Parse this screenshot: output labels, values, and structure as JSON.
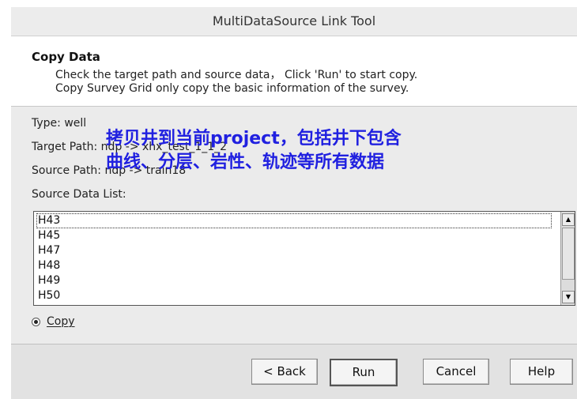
{
  "window": {
    "title": "MultiDataSource Link Tool"
  },
  "header": {
    "title": "Copy Data",
    "line1": "Check the target path and source data， Click 'Run' to start copy.",
    "line2": "Copy Survey Grid only copy the basic information of the survey."
  },
  "fields": {
    "type": "Type:  well",
    "target_path": "Target Path:  ndp -> xhx_test_1_1_2",
    "source_path": "Source Path:  ndp -> train18",
    "source_data_list_label": "Source Data List:"
  },
  "source_list": {
    "items": [
      "H43",
      "H45",
      "H47",
      "H48",
      "H49",
      "H50"
    ]
  },
  "annotation": {
    "line1": "拷贝井到当前project，包括井下包含",
    "line2": "曲线、分层、岩性、轨迹等所有数据",
    "color": "#2020e0"
  },
  "options": {
    "copy_label": "Copy",
    "copy_selected": true
  },
  "buttons": {
    "back": "< Back",
    "run": "Run",
    "cancel": "Cancel",
    "help": "Help"
  }
}
